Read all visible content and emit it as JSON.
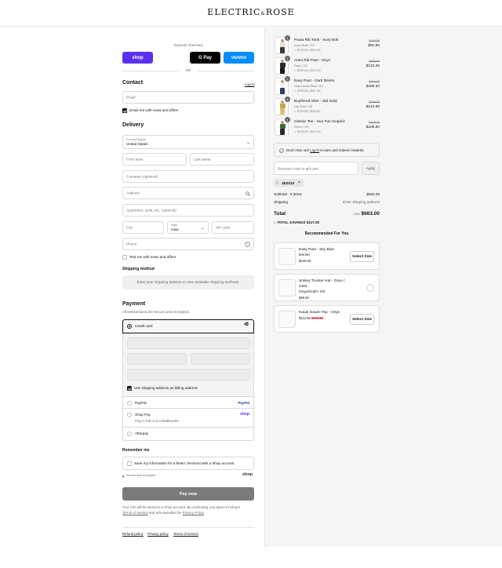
{
  "header": {
    "logo_left": "ELECTRIC",
    "logo_amp": "&",
    "logo_right": "ROSE"
  },
  "express": {
    "title": "Express checkout",
    "shop_label": "shop",
    "gpay_label": "G Pay",
    "venmo_label": "venmo",
    "or_label": "OR"
  },
  "contact": {
    "title": "Contact",
    "login_label": "Log in",
    "email_placeholder": "Email",
    "news_label": "Email me with news and offers"
  },
  "delivery": {
    "title": "Delivery",
    "country_label": "Country/Region",
    "country_value": "United States",
    "first_name": "First name",
    "last_name": "Last name",
    "company": "Company (optional)",
    "address": "Address",
    "apartment": "Apartment, suite, etc. (optional)",
    "city": "City",
    "state_label": "State",
    "state_value": "Iowa",
    "zip": "ZIP code",
    "phone": "Phone",
    "text_label": "Text me with news and offers"
  },
  "shipping": {
    "title": "Shipping method",
    "message": "Enter your shipping address to view available shipping methods."
  },
  "payment": {
    "title": "Payment",
    "subtitle": "All transactions are secure and encrypted.",
    "credit_card": "Credit card",
    "billing_label": "Use shipping address as billing address",
    "paypal": "PayPal",
    "paypal_logo": "PayPal",
    "shoppay": "Shop Pay",
    "shoppay_sub": "Pay in full or in installments",
    "shoppay_logo": "shop",
    "afterpay": "Afterpay"
  },
  "remember": {
    "title": "Remember me",
    "label": "Save my information for a faster checkout with a Shop account",
    "secure": "Secure and encrypted",
    "shop_logo": "shop"
  },
  "pay_button": "Pay now",
  "legal": {
    "line1": "Your info will be saved to a Shop account. By continuing, you agree to Shop's",
    "terms": "Terms of Service",
    "and": " and acknowledge the ",
    "privacy": "Privacy Policy",
    "dot": "."
  },
  "footer": {
    "refund": "Refund policy",
    "privacy": "Privacy policy",
    "terms": "Terms of service"
  },
  "cart": {
    "items": [
      {
        "qty": "1",
        "name": "Paula Rib Tank - Ivory Bolt",
        "variant": "Ivory Multi / XS",
        "discount": "JESS15 (-$16.20)",
        "old": "$108.00",
        "price": "$91.80",
        "top": "#e8e2d4",
        "leg": "#3a3a3a"
      },
      {
        "qty": "1",
        "name": "Aries Rib Pant - Onyx",
        "variant": "Onyx / XS",
        "discount": "JESS15 (-$23.70)",
        "old": "$158.00",
        "price": "$134.30",
        "top": "#2a2a2a",
        "leg": "#1a1a1a"
      },
      {
        "qty": "1",
        "name": "Easy Pant - Dark Denim",
        "variant": "Dark Denim Blue / XS",
        "discount": "JESS15 (-$32.70)",
        "old": "$218.00",
        "price": "$185.30",
        "top": "#f2f2f2",
        "leg": "#2e3f5c"
      },
      {
        "qty": "1",
        "name": "Boyfriend Shirt - Old Gold",
        "variant": "Old Gold / XS",
        "discount": "JESS15 (-$25.20)",
        "old": "$168.00",
        "price": "$142.80",
        "top": "#c8a84a",
        "leg": "#d9c07a"
      },
      {
        "qty": "1",
        "name": "Classic Tee - Sun Fun Graphic",
        "variant": "Green / XS",
        "discount": "JESS15 (-$19.20)",
        "old": "$128.00",
        "price": "$108.80",
        "top": "#3d6b3d",
        "leg": "#2a2a2a"
      }
    ],
    "rewards_pre": "Don't miss out! ",
    "rewards_link": "Log in",
    "rewards_post": " to earn and redeem rewards.",
    "discount_placeholder": "Discount code or gift card",
    "apply_label": "Apply",
    "code_tag": "JESS15",
    "subtotal_label": "Subtotal · 5 items",
    "subtotal_value": "$663.00",
    "shipping_label": "Shipping",
    "shipping_value": "Enter shipping address",
    "total_label": "Total",
    "currency": "USD",
    "total_value": "$663.00",
    "savings_label": "TOTAL SAVINGS",
    "savings_value": "$117.00"
  },
  "recommended": {
    "title": "Recommended For You",
    "items": [
      {
        "name1": "Easy Pant - Sky Blue",
        "name2": "Denim",
        "name3": "",
        "price": "$218.00",
        "old": "",
        "button": "Select Size"
      },
      {
        "name1": "Smiley Trucker Hat - Onyx / Gold -",
        "name2": "Onyx/Gold / OS",
        "name3": "",
        "price": "$48.00",
        "old": "",
        "button": ""
      },
      {
        "name1": "Kauai Gauze Top - Onyx",
        "name2": "",
        "name3": "",
        "price": "$112.80",
        "old": "$188.00",
        "button": "Select Size"
      }
    ]
  },
  "colors": {
    "shop": "#5a31f4",
    "venmo": "#008cff",
    "gpay": "#000000",
    "pay_btn": "#7a7a7a"
  }
}
